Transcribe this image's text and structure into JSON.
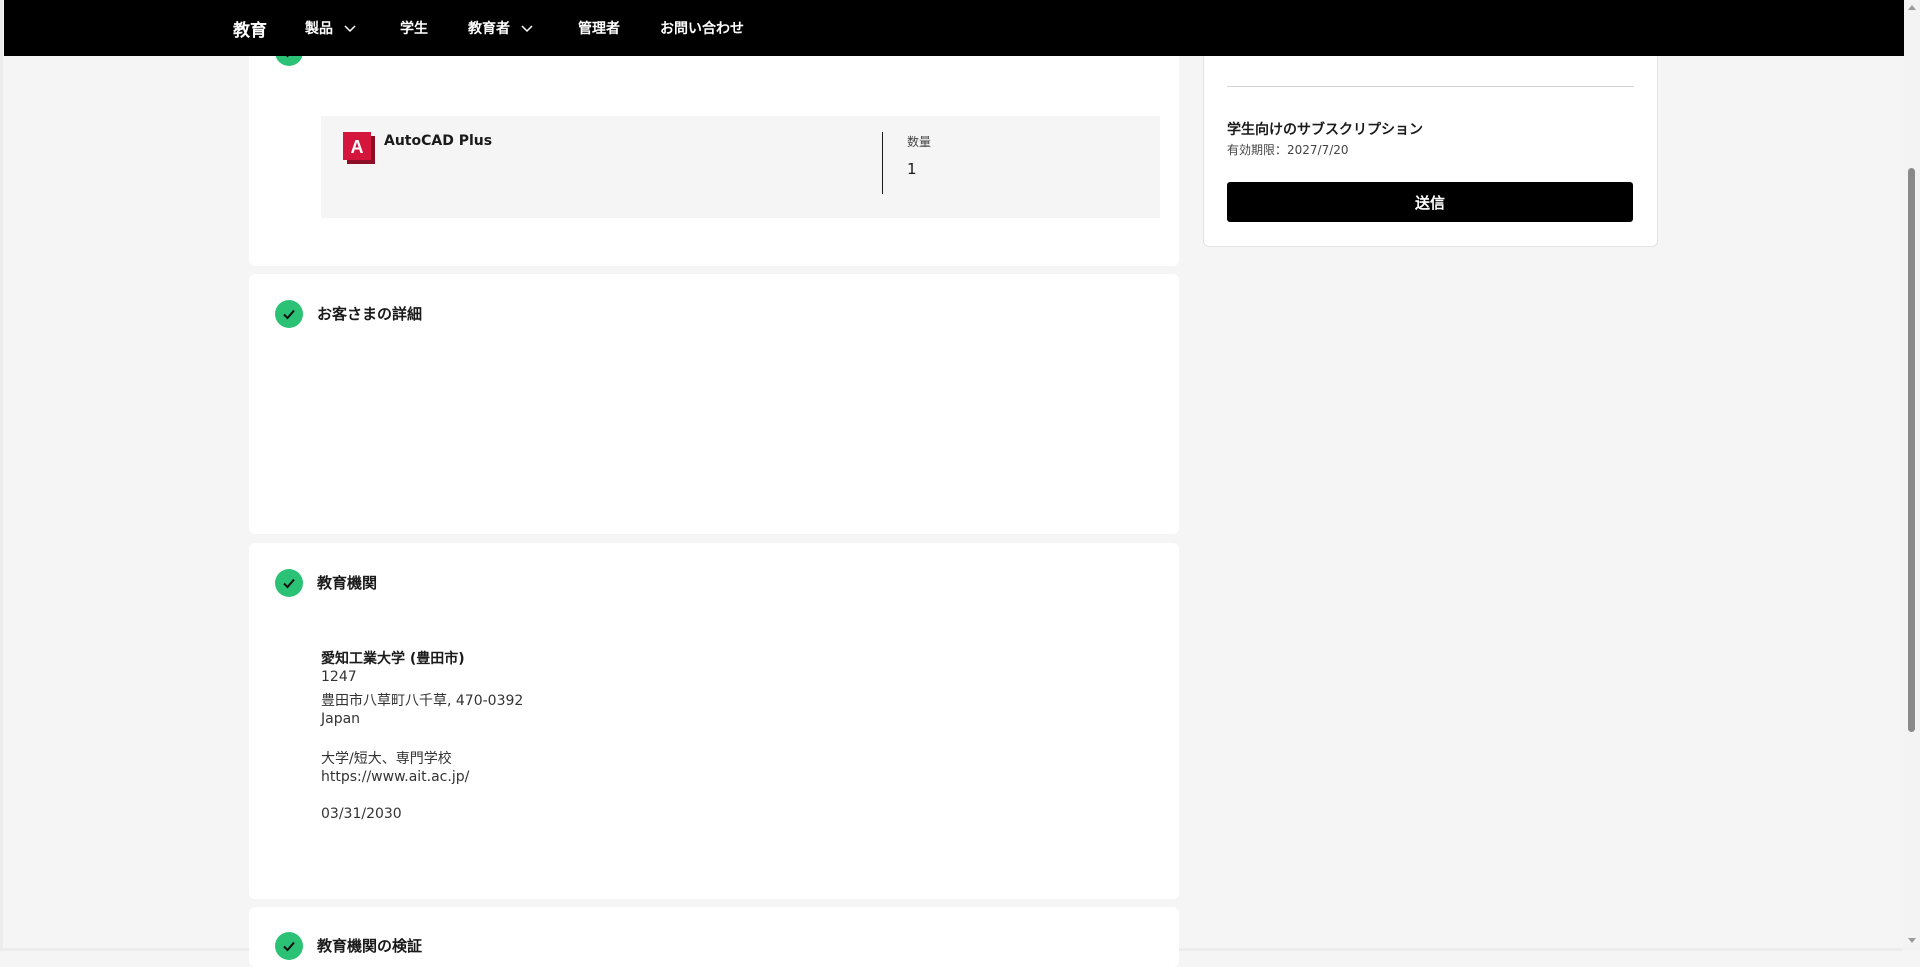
{
  "nav": {
    "brand": "教育",
    "items": [
      {
        "label": "製品",
        "has_dropdown": true
      },
      {
        "label": "学生",
        "has_dropdown": false
      },
      {
        "label": "教育者",
        "has_dropdown": true
      },
      {
        "label": "管理者",
        "has_dropdown": false
      },
      {
        "label": "お問い合わせ",
        "has_dropdown": false
      }
    ]
  },
  "product_section": {
    "product_name": "AutoCAD Plus",
    "logo_letter": "A",
    "quantity_label": "数量",
    "quantity_value": "1"
  },
  "customer_section": {
    "title": "お客さまの詳細"
  },
  "institution_section": {
    "title": "教育機関",
    "name": "愛知工業大学 (豊田市)",
    "code": "1247",
    "address": "豊田市八草町八千草, 470-0392",
    "country": "Japan",
    "type": "大学/短大、専門学校",
    "website": "https://www.ait.ac.jp/",
    "date": "03/31/2030"
  },
  "verification_section": {
    "title": "教育機関の検証"
  },
  "summary": {
    "subscription_title": "学生向けのサブスクリプション",
    "expiry": "有効期限：2027/7/20",
    "submit_label": "送信"
  },
  "colors": {
    "check_green": "#2bc275",
    "nav_bg": "#000000",
    "autocad_red": "#d4163c"
  },
  "icons": {
    "check": "check-icon",
    "dropdown": "chevron-down-icon",
    "product_logo": "autocad-logo-icon"
  }
}
